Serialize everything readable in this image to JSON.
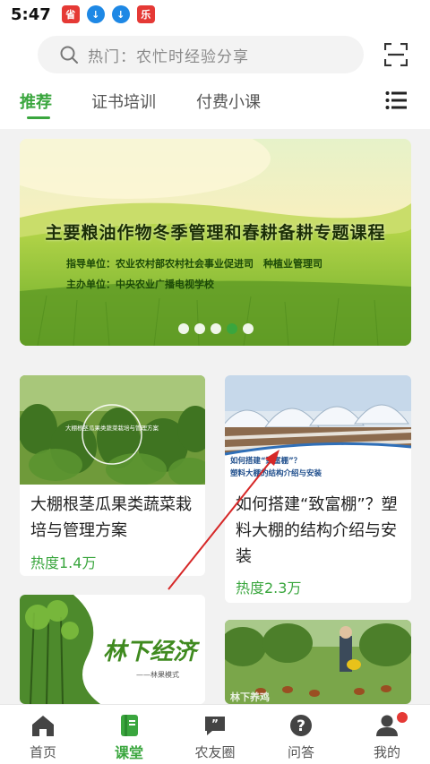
{
  "status_bar": {
    "time": "5:47",
    "icons": [
      {
        "name": "shopping-app-icon",
        "glyph": "省"
      },
      {
        "name": "download-icon",
        "glyph": "↓"
      },
      {
        "name": "download-icon",
        "glyph": "↓"
      },
      {
        "name": "app-notification-icon",
        "glyph": "乐"
      }
    ]
  },
  "search": {
    "placeholder": "热门：农忙时经验分享",
    "icon": "search-icon",
    "scan_icon": "scan-icon"
  },
  "tabs": [
    {
      "label": "推荐",
      "active": true
    },
    {
      "label": "证书培训",
      "active": false
    },
    {
      "label": "付费小课",
      "active": false
    }
  ],
  "menu_icon": "list-menu-icon",
  "banner": {
    "title": "主要粮油作物冬季管理和春耕备耕专题课程",
    "line1": "指导单位：农业农村部农村社会事业促进司　种植业管理司",
    "line2": "主办单位：中央农业广播电视学校",
    "active_slide": 3,
    "slide_count": 5
  },
  "cards": [
    {
      "title_line1": "大棚根茎瓜果类蔬菜栽",
      "title_line2": "培与管理方案",
      "heat": "热度1.4万",
      "image_caption": "大棚根茎瓜果类蔬菜栽培与管理方案"
    },
    {
      "title_line1": "如何搭建“致富棚”？塑",
      "title_line2": "料大棚的结构介绍与安",
      "title_line3": "装",
      "heat": "热度2.3万",
      "image_caption_1": "如何搭建“致富棚”？",
      "image_caption_2": "塑料大棚的结构介绍与安装"
    },
    {
      "image_title": "林下经济",
      "image_subtitle": "——林果模式"
    },
    {
      "image_caption": "林下养鸡"
    }
  ],
  "bottom_nav": [
    {
      "label": "首页",
      "icon": "home-icon",
      "active": false
    },
    {
      "label": "课堂",
      "icon": "classroom-book-icon",
      "active": true
    },
    {
      "label": "农友圈",
      "icon": "chat-bubble-icon",
      "active": false
    },
    {
      "label": "问答",
      "icon": "question-icon",
      "active": false
    },
    {
      "label": "我的",
      "icon": "profile-icon",
      "active": false,
      "badge": true
    }
  ],
  "colors": {
    "accent": "#3aa63e",
    "badge": "#e53935"
  }
}
